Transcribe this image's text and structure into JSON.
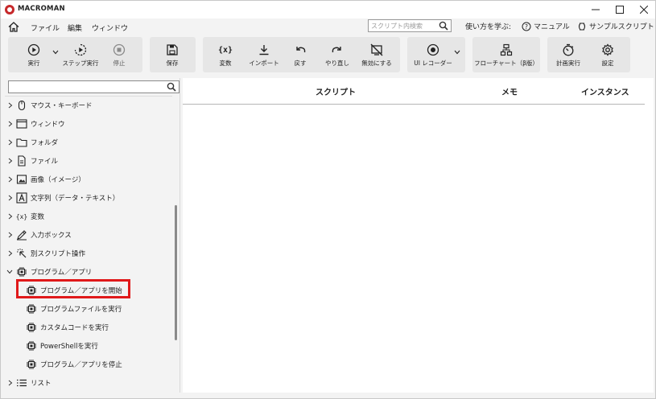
{
  "app": {
    "title": "MACROMAN"
  },
  "window_controls": {
    "minimize": "—",
    "maximize": "☐",
    "close": "✕"
  },
  "menu": {
    "items": [
      "ファイル",
      "編集",
      "ウィンドウ"
    ]
  },
  "search": {
    "placeholder": "スクリプト内検索"
  },
  "help": {
    "how_to": "使い方を学ぶ:",
    "manual": "マニュアル",
    "samples": "サンプルスクリプト"
  },
  "toolbar": {
    "run": "実行",
    "step_run": "ステップ実行",
    "stop": "停止",
    "save": "保存",
    "variable": "変数",
    "import": "インポート",
    "undo": "戻す",
    "redo": "やり直し",
    "disable": "無効にする",
    "ui_recorder": "UI レコーダー",
    "flowchart": "フローチャート（β版）",
    "schedule": "計画実行",
    "settings": "設定",
    "variable_icon_text": "{x}"
  },
  "tree": {
    "search_value": "",
    "items": [
      {
        "label": "マウス・キーボード",
        "icon": "mouse-icon",
        "expanded": false
      },
      {
        "label": "ウィンドウ",
        "icon": "window-icon",
        "expanded": false
      },
      {
        "label": "フォルダ",
        "icon": "folder-icon",
        "expanded": false
      },
      {
        "label": "ファイル",
        "icon": "file-icon",
        "expanded": false
      },
      {
        "label": "画像（イメージ）",
        "icon": "image-icon",
        "expanded": false
      },
      {
        "label": "文字列（データ・テキスト）",
        "icon": "text-icon",
        "expanded": false
      },
      {
        "label": "変数",
        "icon": "variable-icon",
        "expanded": false
      },
      {
        "label": "入力ボックス",
        "icon": "input-box-icon",
        "expanded": false
      },
      {
        "label": "別スクリプト操作",
        "icon": "script-op-icon",
        "expanded": false
      },
      {
        "label": "プログラム／アプリ",
        "icon": "chip-icon",
        "expanded": true
      },
      {
        "label": "リスト",
        "icon": "list-icon",
        "expanded": false
      }
    ],
    "children": [
      {
        "label": "プログラム／アプリを開始",
        "icon": "chip-icon",
        "selected": true
      },
      {
        "label": "プログラムファイルを実行",
        "icon": "chip-icon"
      },
      {
        "label": "カスタムコードを実行",
        "icon": "chip-icon"
      },
      {
        "label": "PowerShellを実行",
        "icon": "chip-icon"
      },
      {
        "label": "プログラム／アプリを停止",
        "icon": "chip-icon"
      }
    ],
    "variable_icon_text": "{x}"
  },
  "table": {
    "columns": [
      "スクリプト",
      "メモ",
      "インスタンス"
    ]
  },
  "colors": {
    "highlight": "#e0191a",
    "logo": "#c6282a",
    "toolbar_group": "#e6e6e6"
  }
}
